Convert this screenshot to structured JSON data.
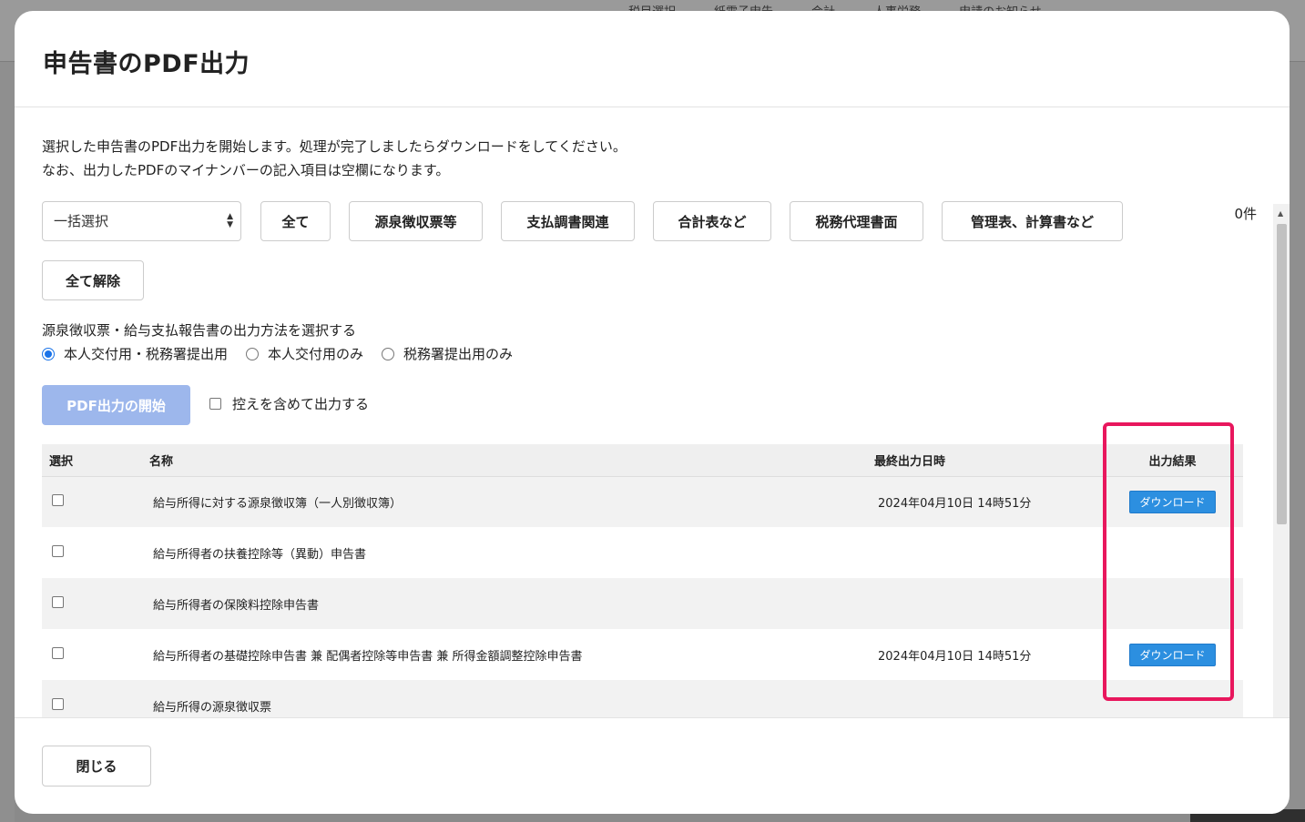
{
  "background": {
    "nav": [
      "税目選択",
      "紙電子申告",
      "会計",
      "人事労務",
      "申請のお知らせ"
    ]
  },
  "modal": {
    "title": "申告書のPDF出力",
    "description_line1": "選択した申告書のPDF出力を開始します。処理が完了しましたらダウンロードをしてください。",
    "description_line2": "なお、出力したPDFのマイナンバーの記入項目は空欄になります。",
    "bulk_select": {
      "value": "一括選択"
    },
    "filter_buttons": [
      "全て",
      "源泉徴収票等",
      "支払調書関連",
      "合計表など",
      "税務代理書面",
      "管理表、計算書など"
    ],
    "clear_all": "全て解除",
    "count": "0件",
    "method_label": "源泉徴収票・給与支払報告書の出力方法を選択する",
    "radio_options": [
      {
        "label": "本人交付用・税務署提出用",
        "checked": true
      },
      {
        "label": "本人交付用のみ",
        "checked": false
      },
      {
        "label": "税務署提出用のみ",
        "checked": false
      }
    ],
    "start_button": "PDF出力の開始",
    "include_copy": "控えを含めて出力する",
    "table": {
      "headers": {
        "select": "選択",
        "name": "名称",
        "last_output": "最終出力日時",
        "result": "出力結果"
      },
      "rows": [
        {
          "name": "給与所得に対する源泉徴収簿（一人別徴収簿）",
          "last_output": "2024年04月10日 14時51分",
          "result": "ダウンロード"
        },
        {
          "name": "給与所得者の扶養控除等（異動）申告書",
          "last_output": "",
          "result": ""
        },
        {
          "name": "給与所得者の保険料控除申告書",
          "last_output": "",
          "result": ""
        },
        {
          "name": "給与所得者の基礎控除申告書 兼 配偶者控除等申告書 兼 所得金額調整控除申告書",
          "last_output": "2024年04月10日 14時51分",
          "result": "ダウンロード"
        },
        {
          "name": "給与所得の源泉徴収票",
          "last_output": "",
          "result": ""
        }
      ]
    },
    "close_button": "閉じる",
    "colors": {
      "primary": "#2c8fe0",
      "disabled_primary": "#9db7ec",
      "highlight": "#e8175d"
    }
  }
}
